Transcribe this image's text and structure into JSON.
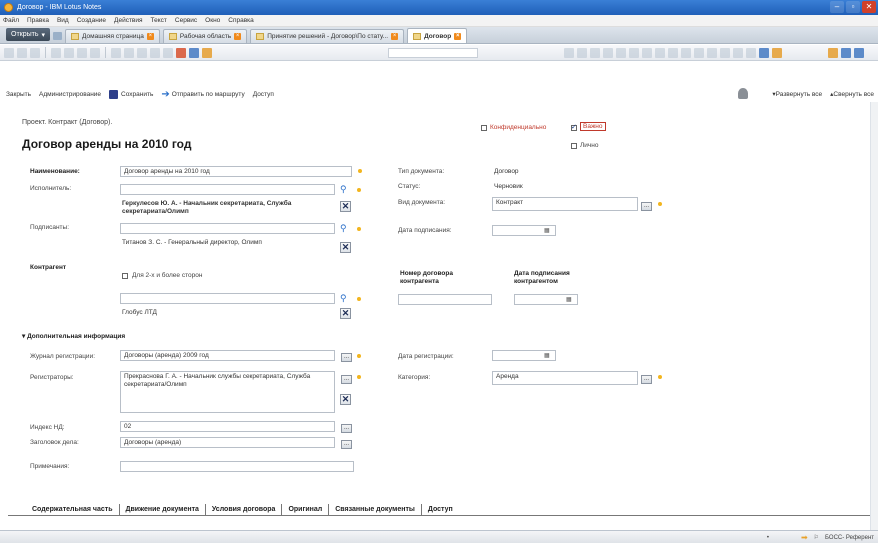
{
  "window": {
    "title": "Договор - IBM Lotus Notes",
    "min": "–",
    "max": "▫",
    "close": "✕"
  },
  "menu": [
    "Файл",
    "Правка",
    "Вид",
    "Создание",
    "Действия",
    "Текст",
    "Сервис",
    "Окно",
    "Справка"
  ],
  "tabs": {
    "open_label": "Открыть",
    "items": [
      {
        "label": "Домашняя страница",
        "active": false
      },
      {
        "label": "Рабочая область",
        "active": false
      },
      {
        "label": "Принятие решений - Договор\\По стату...",
        "active": false
      },
      {
        "label": "Договор",
        "active": true
      }
    ]
  },
  "actions": {
    "close": "Закрыть",
    "admin": "Администрирование",
    "save": "Сохранить",
    "send": "Отправить по маршруту",
    "access": "Доступ",
    "expand_all": "▾Развернуть все",
    "collapse_all": "▴Свернуть все"
  },
  "form": {
    "breadcrumb": "Проект. Контракт (Договор).",
    "title": "Договор аренды на 2010 год",
    "flags": {
      "confidential": {
        "label": "Конфиденциально",
        "checked": false
      },
      "important": {
        "label": "Важно",
        "checked": true
      },
      "personal": {
        "label": "Лично",
        "checked": false
      }
    },
    "name_label": "Наименование:",
    "name_value": "Договор аренды на 2010 год",
    "executor_label": "Исполнитель:",
    "executor_value": "Геркулесов Ю. А. - Начальник секретариата, Служба секретариата/Олимп",
    "signers_label": "Подписанты:",
    "signers_value": "Титанов З. С. - Генеральный директор, Олимп",
    "doc_type_label": "Тип документа:",
    "doc_type_value": "Договор",
    "status_label": "Статус:",
    "status_value": "Черновик",
    "doc_kind_label": "Вид документа:",
    "doc_kind_value": "Контракт",
    "sign_date_label": "Дата подписания:",
    "counterparty_label": "Контрагент",
    "multi_party_label": "Для 2-х и более сторон",
    "counterparty_value": "Глобус ЛТД",
    "cp_number_label": "Номер договора контрагента",
    "cp_date_label": "Дата подписания контрагентом",
    "additional_label": "Дополнительная информация",
    "journal_label": "Журнал регистрации:",
    "journal_value": "Договоры (аренда) 2009 год",
    "reg_date_label": "Дата регистрации:",
    "registrars_label": "Регистраторы:",
    "registrars_value": "Прекраснова Г. А. - Начальник службы секретариата, Служба секретариата/Олимп",
    "category_label": "Категория:",
    "category_value": "Аренда",
    "index_label": "Индекс НД:",
    "index_value": "02",
    "case_title_label": "Заголовок дела:",
    "case_title_value": "Договоры (аренда)",
    "notes_label": "Примечания:"
  },
  "bottom_tabs": [
    "Содержательная часть",
    "Движение документа",
    "Условия договора",
    "Оригинал",
    "Связанные документы",
    "Доступ"
  ],
  "status": {
    "right_text": "БОСС- Референт"
  },
  "colors": {
    "accent": "#2a6fc9",
    "required_dot": "#f2b51e",
    "important": "#c0392b"
  }
}
